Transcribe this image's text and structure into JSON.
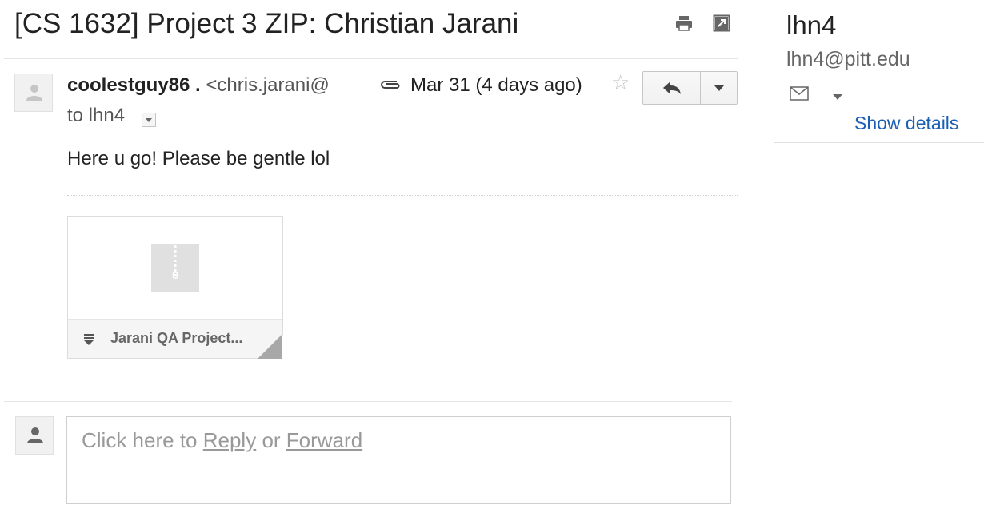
{
  "email": {
    "subject": "[CS 1632] Project 3 ZIP: Christian Jarani",
    "sender_name": "coolestguy86 .",
    "sender_email": "<chris.jarani@",
    "date": "Mar 31 (4 days ago)",
    "to_label": "to lhn4",
    "body": "Here u go! Please be gentle lol"
  },
  "attachment": {
    "name": "Jarani QA Project..."
  },
  "reply_box": {
    "prefix": "Click here to ",
    "reply_link": "Reply",
    "middle": " or ",
    "forward_link": "Forward"
  },
  "sidebar": {
    "name": "lhn4",
    "email": "lhn4@pitt.edu",
    "show_details": "Show details"
  },
  "icons": {
    "print": "print-icon",
    "new_window": "open-in-new-window-icon",
    "attachment": "paperclip-icon",
    "star": "star-icon",
    "reply": "reply-icon",
    "more": "chevron-down-icon",
    "avatar": "person-icon",
    "zip": "zip-file-icon",
    "download": "download-icon",
    "mail": "envelope-icon"
  },
  "colors": {
    "link": "#1a5fb4",
    "muted_text": "#999999",
    "star": "#c6c6c6"
  }
}
